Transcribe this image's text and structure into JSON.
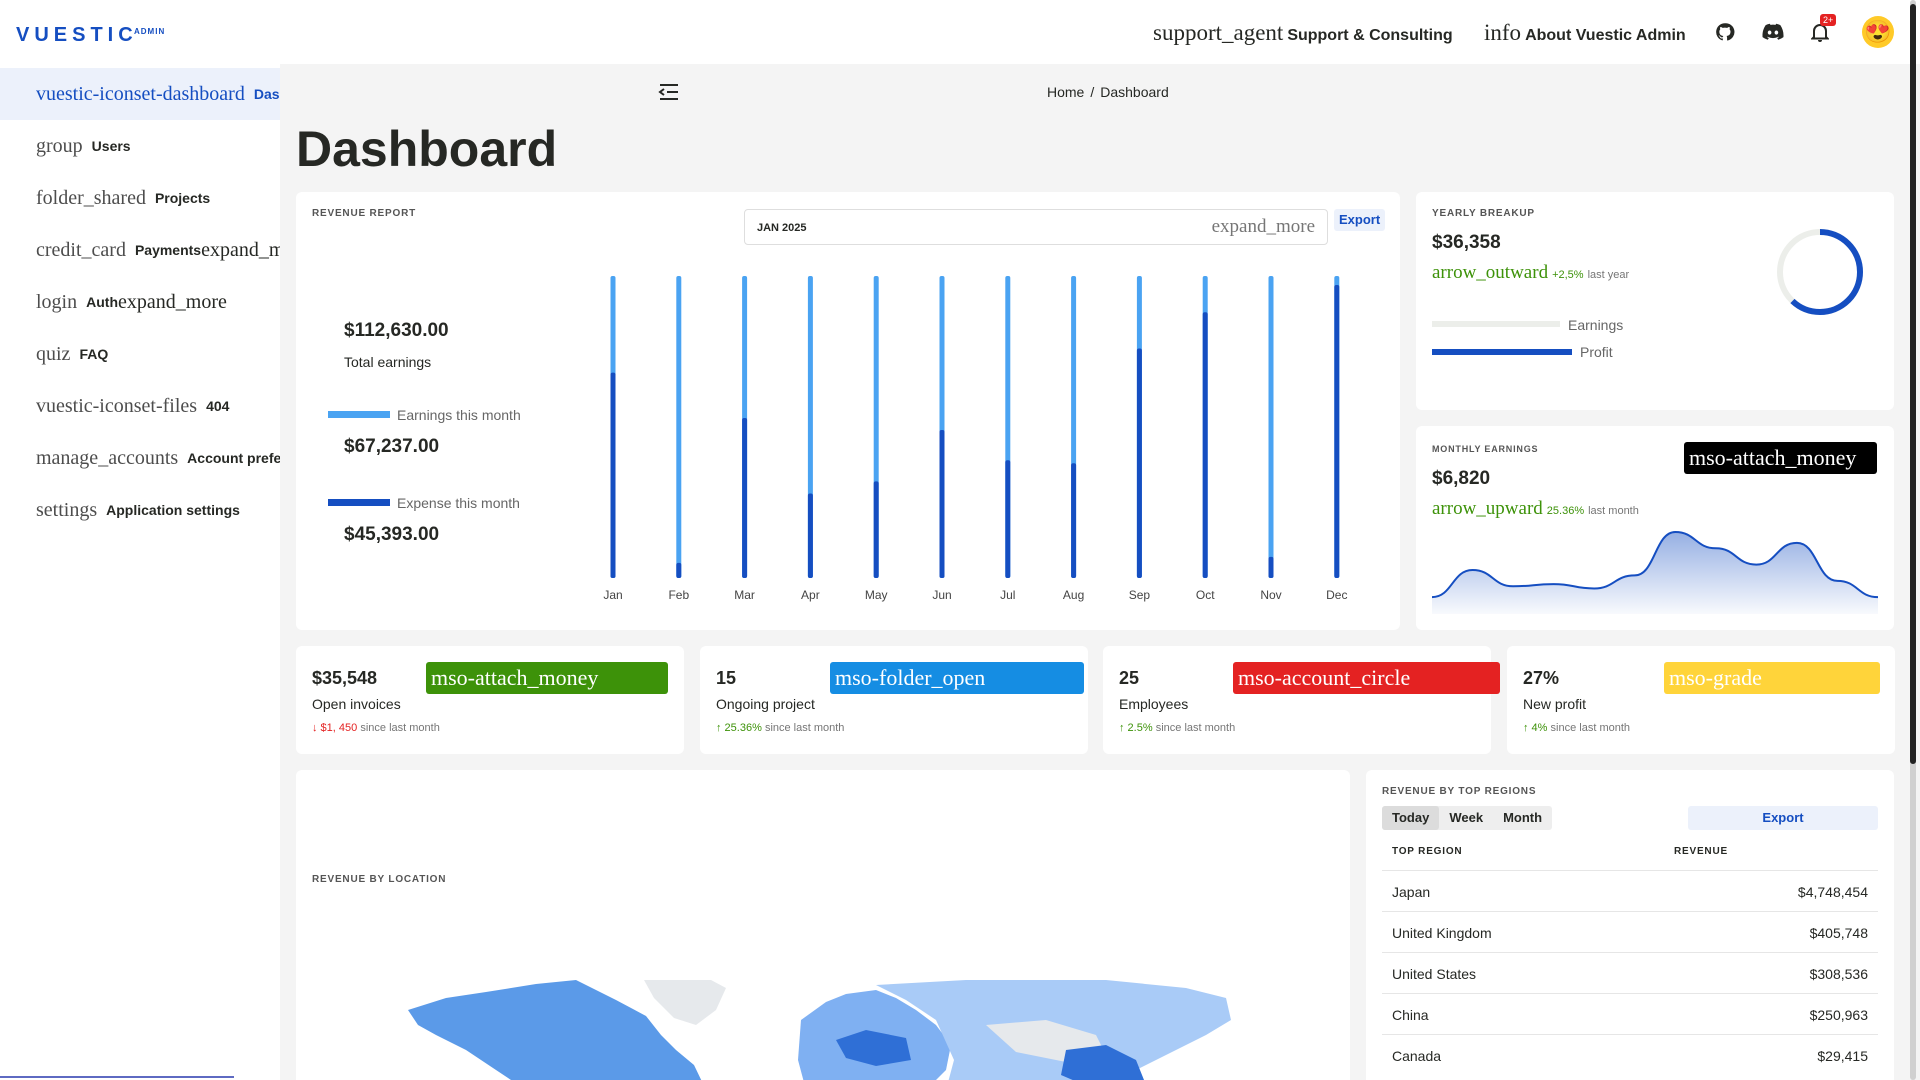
{
  "topbar": {
    "logo": "VUESTIC",
    "logo_sub": "ADMIN",
    "support_icon": "support_agent",
    "support_label": "Support & Consulting",
    "info_icon": "info",
    "info_label": "About Vuestic Admin",
    "notification_badge": "2+"
  },
  "sidebar": {
    "items": [
      {
        "icon": "vuestic-iconset-dashboard",
        "label": "Dashboard",
        "active": true
      },
      {
        "icon": "group",
        "label": "Users"
      },
      {
        "icon": "folder_shared",
        "label": "Projects"
      },
      {
        "icon": "credit_card",
        "label": "Payments",
        "expand": "expand_more"
      },
      {
        "icon": "login",
        "label": "Auth",
        "expand": "expand_more"
      },
      {
        "icon": "quiz",
        "label": "FAQ"
      },
      {
        "icon": "vuestic-iconset-files",
        "label": "404"
      },
      {
        "icon": "manage_accounts",
        "label": "Account preferences"
      },
      {
        "icon": "settings",
        "label": "Application settings"
      }
    ]
  },
  "breadcrumb": {
    "home": "Home",
    "sep": "/",
    "current": "Dashboard"
  },
  "page_title": "Dashboard",
  "revenue_report": {
    "title": "REVENUE REPORT",
    "month_select": "JAN 2025",
    "select_icon": "expand_more",
    "export_label": "Export",
    "total_value": "$112,630.00",
    "total_label": "Total earnings",
    "earnings_label": "Earnings this month",
    "earnings_value": "$67,237.00",
    "expense_label": "Expense this month",
    "expense_value": "$45,393.00"
  },
  "chart_data": {
    "type": "bar",
    "categories": [
      "Jan",
      "Feb",
      "Mar",
      "Apr",
      "May",
      "Jun",
      "Jul",
      "Aug",
      "Sep",
      "Oct",
      "Nov",
      "Dec"
    ],
    "series": [
      {
        "name": "Earnings this month",
        "values": [
          100,
          100,
          100,
          100,
          100,
          100,
          100,
          100,
          100,
          100,
          100,
          100
        ]
      },
      {
        "name": "Expense this month",
        "values": [
          68,
          5,
          53,
          28,
          32,
          49,
          39,
          38,
          76,
          88,
          7,
          97
        ]
      }
    ],
    "ylim": [
      0,
      100
    ]
  },
  "colors": {
    "earnings": "#4aa3f2",
    "expense": "#154ec1",
    "success": "#3d9209",
    "danger": "#e42222",
    "primary": "#154ec1"
  },
  "yearly_breakup": {
    "title": "YEARLY BREAKUP",
    "value": "$36,358",
    "trend_icon": "arrow_outward",
    "trend_pct": "+2,5%",
    "trend_text": "last year",
    "legend_earnings": "Earnings",
    "legend_profit": "Profit",
    "profit_share": 0.62
  },
  "monthly_earnings": {
    "title": "MONTHLY EARNINGS",
    "chip": "mso-attach_money",
    "value": "$6,820",
    "trend_icon": "arrow_upward",
    "trend_pct": "25.36%",
    "trend_text": "last month",
    "spark": [
      10,
      35,
      20,
      22,
      18,
      30,
      70,
      55,
      40,
      60,
      25,
      10
    ]
  },
  "stat_cards": [
    {
      "value": "$35,548",
      "label": "Open invoices",
      "chip": "mso-attach_money",
      "chip_color": "#3d9209",
      "change": "↓ $1, 450",
      "change_dir": "down",
      "suffix": "since last month"
    },
    {
      "value": "15",
      "label": "Ongoing project",
      "chip": "mso-folder_open",
      "chip_color": "#158de3",
      "change": "↑ 25.36%",
      "change_dir": "up",
      "suffix": "since last month"
    },
    {
      "value": "25",
      "label": "Employees",
      "chip": "mso-account_circle",
      "chip_color": "#e42222",
      "change": "↑ 2.5%",
      "change_dir": "up",
      "suffix": "since last month"
    },
    {
      "value": "27%",
      "label": "New profit",
      "chip": "mso-grade",
      "chip_color": "#ffd43a",
      "change": "↑ 4%",
      "change_dir": "up",
      "suffix": "since last month"
    }
  ],
  "revenue_location": {
    "title": "REVENUE BY LOCATION"
  },
  "regions": {
    "title": "REVENUE BY TOP REGIONS",
    "tabs": [
      "Today",
      "Week",
      "Month"
    ],
    "export_label": "Export",
    "col_region": "TOP REGION",
    "col_revenue": "REVENUE",
    "rows": [
      {
        "region": "Japan",
        "revenue": "$4,748,454"
      },
      {
        "region": "United Kingdom",
        "revenue": "$405,748"
      },
      {
        "region": "United States",
        "revenue": "$308,536"
      },
      {
        "region": "China",
        "revenue": "$250,963"
      },
      {
        "region": "Canada",
        "revenue": "$29,415"
      }
    ]
  }
}
